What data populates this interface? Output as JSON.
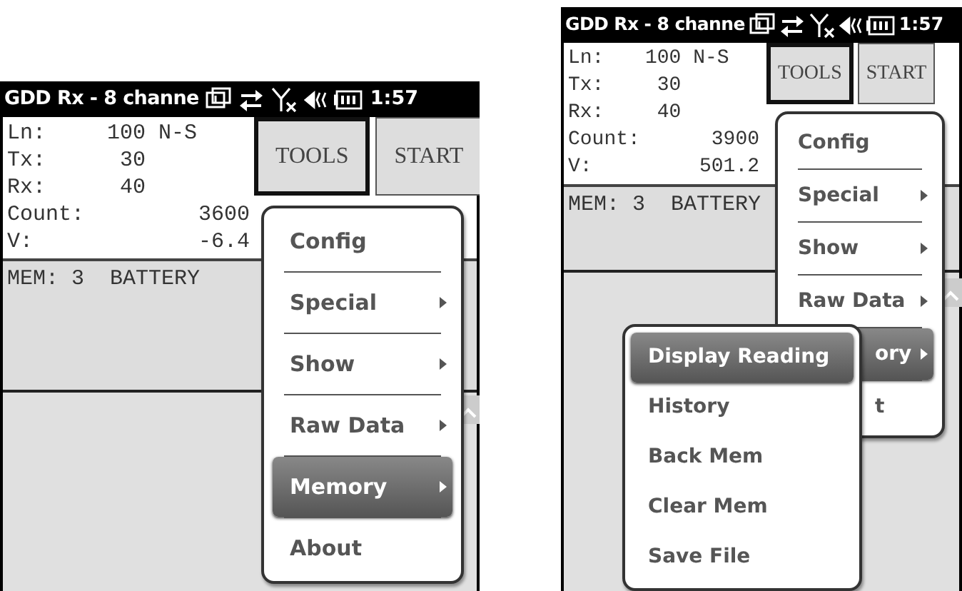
{
  "screens": [
    {
      "title": "GDD Rx - 8 channe",
      "time": "1:57",
      "fields": [
        {
          "label": "Ln:",
          "value": "100 N-S"
        },
        {
          "label": "Tx:",
          "value": " 30"
        },
        {
          "label": "Rx:",
          "value": " 40"
        },
        {
          "label": "Count:",
          "value": "3600"
        },
        {
          "label": "V:",
          "value": "-6.4"
        }
      ],
      "buttons": [
        {
          "label": "TOOLS",
          "selected": true
        },
        {
          "label": "START",
          "selected": false
        }
      ],
      "status": "MEM: 3  BATTERY",
      "menu": [
        {
          "label": "Config",
          "submenu": false,
          "selected": false,
          "covered": false
        },
        {
          "label": "Special",
          "submenu": true,
          "selected": false,
          "covered": false
        },
        {
          "label": "Show",
          "submenu": true,
          "selected": false,
          "covered": false
        },
        {
          "label": "Raw Data",
          "submenu": true,
          "selected": false,
          "covered": false
        },
        {
          "label": "Memory",
          "submenu": true,
          "selected": true,
          "covered": false
        },
        {
          "label": "About",
          "submenu": false,
          "selected": false,
          "covered": false
        }
      ]
    },
    {
      "title": "GDD Rx - 8 channe",
      "time": "1:57",
      "fields": [
        {
          "label": "Ln:",
          "value": "100 N-S"
        },
        {
          "label": "Tx:",
          "value": " 30"
        },
        {
          "label": "Rx:",
          "value": " 40"
        },
        {
          "label": "Count:",
          "value": "3900"
        },
        {
          "label": "V:",
          "value": "501.2"
        }
      ],
      "buttons": [
        {
          "label": "TOOLS",
          "selected": true
        },
        {
          "label": "START",
          "selected": false
        }
      ],
      "status": "MEM: 3  BATTERY",
      "menu": [
        {
          "label": "Config",
          "submenu": false,
          "selected": false,
          "covered": false
        },
        {
          "label": "Special",
          "submenu": true,
          "selected": false,
          "covered": false
        },
        {
          "label": "Show",
          "submenu": true,
          "selected": false,
          "covered": false
        },
        {
          "label": "Raw Data",
          "submenu": true,
          "selected": false,
          "covered": false
        },
        {
          "label": "ory",
          "submenu": true,
          "selected": true,
          "covered": true
        },
        {
          "label": "t",
          "submenu": false,
          "selected": false,
          "covered": true
        }
      ],
      "submenu": [
        {
          "label": "Display Reading",
          "selected": true
        },
        {
          "label": "History",
          "selected": false
        },
        {
          "label": "Back Mem",
          "selected": false
        },
        {
          "label": "Clear Mem",
          "selected": false
        },
        {
          "label": "Save File",
          "selected": false
        }
      ]
    }
  ]
}
